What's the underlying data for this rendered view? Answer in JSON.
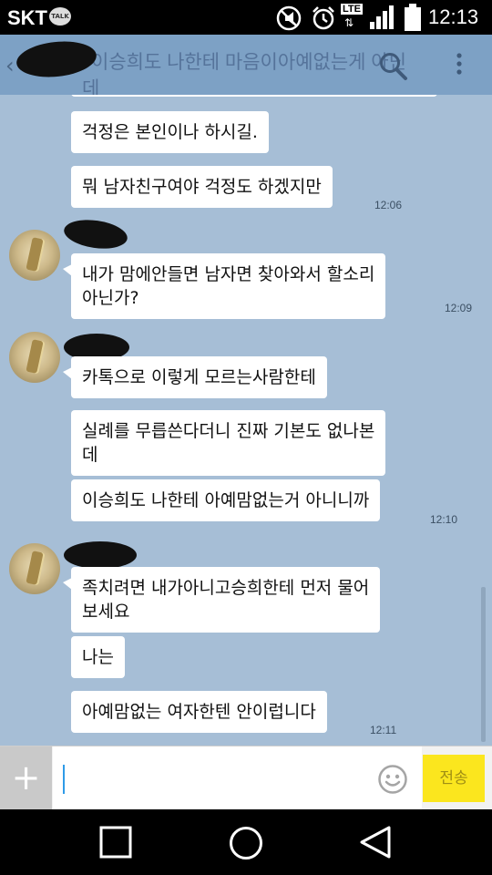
{
  "status_bar": {
    "carrier": "SKT",
    "talk_badge": "TALK",
    "network": "LTE",
    "time": "12:13",
    "icons": [
      "mute-icon",
      "alarm-icon",
      "lte-icon",
      "signal-icon",
      "battery-icon"
    ]
  },
  "header": {
    "title_line1": "이승희도 나한테 마음이아예없는게 아닌",
    "title_line2": "데",
    "icons": [
      "back-chevron-icon",
      "search-icon",
      "more-vertical-icon"
    ]
  },
  "messages": [
    {
      "text": "걱정은 본인이나 하시길."
    },
    {
      "text": "뭐 남자친구여야 걱정도 하겠지만",
      "time": "12:06"
    },
    {
      "text": "내가 맘에안들면 남자면 찾아와서 할소리 아닌가?",
      "line1": "내가 맘에안들면 남자면 찾아와서 할소리",
      "line2": "아닌가?",
      "time": "12:09"
    },
    {
      "text": "카톡으로 이렇게 모르는사람한테"
    },
    {
      "text": "실례를 무릅쓴다더니 진짜 기본도 없나본데",
      "line1": "실례를 무릅쓴다더니 진짜 기본도 없나본",
      "line2": "데"
    },
    {
      "text": "이승희도 나한테 아예맘없는거 아니니까",
      "time": "12:10"
    },
    {
      "text": "족치려면 내가아니고승희한테 먼저 물어보세요",
      "line1": "족치려면 내가아니고승희한테 먼저 물어",
      "line2": "보세요"
    },
    {
      "text": "나는"
    },
    {
      "text": "아예맘없는 여자한텐 안이럽니다",
      "time": "12:11"
    }
  ],
  "input_bar": {
    "plus_label": "+",
    "send_label": "전송",
    "emoji_icon": "smiley-icon"
  },
  "nav_bar": {
    "icons": [
      "recent-apps-icon",
      "home-icon",
      "back-icon"
    ]
  },
  "colors": {
    "chat_background": "#a6bed6",
    "header_background": "#7da1c5",
    "send_button": "#fbe61e",
    "bubble": "#ffffff"
  }
}
